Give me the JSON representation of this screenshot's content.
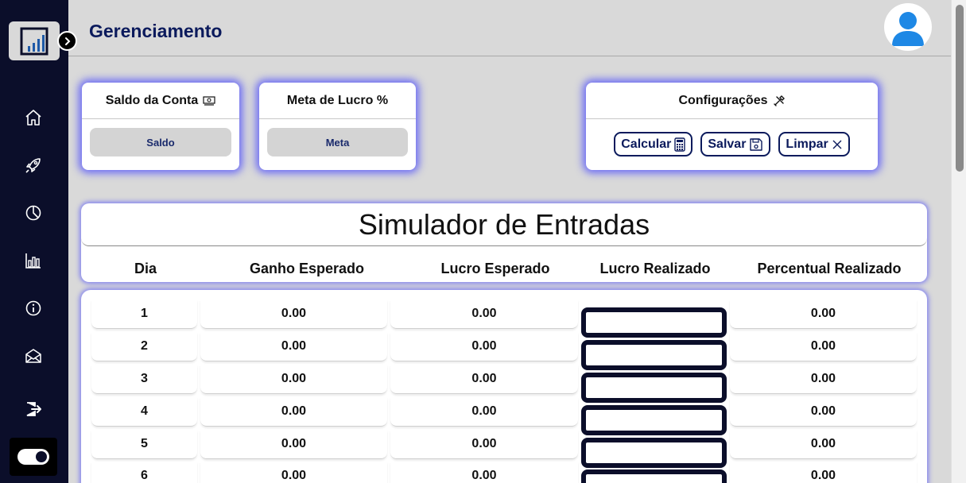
{
  "header": {
    "title": "Gerenciamento"
  },
  "sidebar": {
    "items": [
      {
        "name": "home",
        "icon": "home-icon"
      },
      {
        "name": "rocket",
        "icon": "rocket-icon"
      },
      {
        "name": "chart-pie",
        "icon": "pie-chart-icon"
      },
      {
        "name": "bar-chart",
        "icon": "bar-chart-icon"
      },
      {
        "name": "info",
        "icon": "info-icon"
      },
      {
        "name": "mail",
        "icon": "envelope-icon"
      },
      {
        "name": "logout",
        "icon": "logout-icon"
      }
    ]
  },
  "cards": {
    "saldo": {
      "title": "Saldo da Conta",
      "icon": "money-icon",
      "placeholder": "Saldo"
    },
    "meta": {
      "title": "Meta de Lucro %",
      "placeholder": "Meta"
    },
    "config": {
      "title": "Configurações",
      "icon": "tools-icon",
      "buttons": {
        "calcular": "Calcular",
        "salvar": "Salvar",
        "limpar": "Limpar"
      }
    }
  },
  "simulator": {
    "title": "Simulador de Entradas",
    "columns": [
      "Dia",
      "Ganho Esperado",
      "Lucro Esperado",
      "Lucro Realizado",
      "Percentual Realizado"
    ],
    "rows": [
      {
        "dia": "1",
        "ganho": "0.00",
        "lucro": "0.00",
        "realizado": "",
        "percentual": "0.00"
      },
      {
        "dia": "2",
        "ganho": "0.00",
        "lucro": "0.00",
        "realizado": "",
        "percentual": "0.00"
      },
      {
        "dia": "3",
        "ganho": "0.00",
        "lucro": "0.00",
        "realizado": "",
        "percentual": "0.00"
      },
      {
        "dia": "4",
        "ganho": "0.00",
        "lucro": "0.00",
        "realizado": "",
        "percentual": "0.00"
      },
      {
        "dia": "5",
        "ganho": "0.00",
        "lucro": "0.00",
        "realizado": "",
        "percentual": "0.00"
      },
      {
        "dia": "6",
        "ganho": "0.00",
        "lucro": "0.00",
        "realizado": "",
        "percentual": "0.00"
      }
    ]
  },
  "colors": {
    "accent": "#0b1a5c",
    "sidebar": "#0b0e2a",
    "glow": "#4646ff",
    "avatar": "#1e88e5"
  }
}
